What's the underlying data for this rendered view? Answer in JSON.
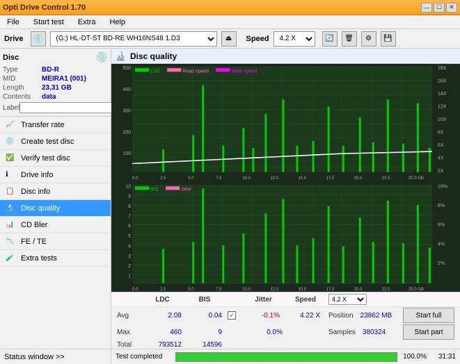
{
  "app": {
    "title": "Opti Drive Control 1.70",
    "title_controls": [
      "—",
      "☐",
      "✕"
    ]
  },
  "menu": {
    "items": [
      "File",
      "Start test",
      "Extra",
      "Help"
    ]
  },
  "drive": {
    "label": "Drive",
    "selected": "(G:) HL-DT-ST BD-RE  WH16NS48 1.D3",
    "speed_label": "Speed",
    "speed_value": "4.2 X"
  },
  "disc": {
    "title": "Disc",
    "type_label": "Type",
    "type_value": "BD-R",
    "mid_label": "MID",
    "mid_value": "MEIRA1 (001)",
    "length_label": "Length",
    "length_value": "23,31 GB",
    "contents_label": "Contents",
    "contents_value": "data",
    "label_label": "Label",
    "label_input": ""
  },
  "nav": {
    "items": [
      {
        "id": "transfer-rate",
        "label": "Transfer rate",
        "active": false
      },
      {
        "id": "create-test-disc",
        "label": "Create test disc",
        "active": false
      },
      {
        "id": "verify-test-disc",
        "label": "Verify test disc",
        "active": false
      },
      {
        "id": "drive-info",
        "label": "Drive info",
        "active": false
      },
      {
        "id": "disc-info",
        "label": "Disc info",
        "active": false
      },
      {
        "id": "disc-quality",
        "label": "Disc quality",
        "active": true
      },
      {
        "id": "cd-bler",
        "label": "CD Bler",
        "active": false
      },
      {
        "id": "fe-te",
        "label": "FE / TE",
        "active": false
      },
      {
        "id": "extra-tests",
        "label": "Extra tests",
        "active": false
      }
    ]
  },
  "status_window": "Status window >>",
  "dq_title": "Disc quality",
  "chart_top": {
    "legend": [
      "LDC",
      "Read speed",
      "Write speed"
    ],
    "y_left_max": 500,
    "y_right_labels": [
      "18X",
      "16X",
      "14X",
      "12X",
      "10X",
      "8X",
      "6X",
      "4X",
      "2X"
    ],
    "x_labels": [
      "0.0",
      "2.5",
      "5.0",
      "7.5",
      "10.0",
      "12.5",
      "15.0",
      "17.5",
      "20.0",
      "22.5",
      "25.0 GB"
    ]
  },
  "chart_bottom": {
    "legend": [
      "BIS",
      "Jitter"
    ],
    "y_left_labels": [
      "10",
      "9",
      "8",
      "7",
      "6",
      "5",
      "4",
      "3",
      "2",
      "1"
    ],
    "y_right_labels": [
      "10%",
      "8%",
      "6%",
      "4%",
      "2%"
    ],
    "x_labels": [
      "0.0",
      "2.5",
      "5.0",
      "7.5",
      "10.0",
      "12.5",
      "15.0",
      "17.5",
      "20.0",
      "22.5",
      "25.0 GB"
    ]
  },
  "stats": {
    "col_ldc": "LDC",
    "col_bis": "BIS",
    "col_jitter": "Jitter",
    "col_speed": "Speed",
    "col_position": "Position",
    "avg_label": "Avg",
    "avg_ldc": "2.08",
    "avg_bis": "0.04",
    "jitter_checked": true,
    "avg_jitter": "-0.1%",
    "speed_val": "4.22 X",
    "position_val": "23862 MB",
    "max_label": "Max",
    "max_ldc": "460",
    "max_bis": "9",
    "max_jitter": "0.0%",
    "total_label": "Total",
    "total_ldc": "793512",
    "total_bis": "14596",
    "samples_label": "Samples",
    "samples_val": "380324",
    "speed_select": "4.2 X"
  },
  "buttons": {
    "start_full": "Start full",
    "start_part": "Start part"
  },
  "progress": {
    "status": "Test completed",
    "pct": "100.0%",
    "time": "31:31"
  }
}
